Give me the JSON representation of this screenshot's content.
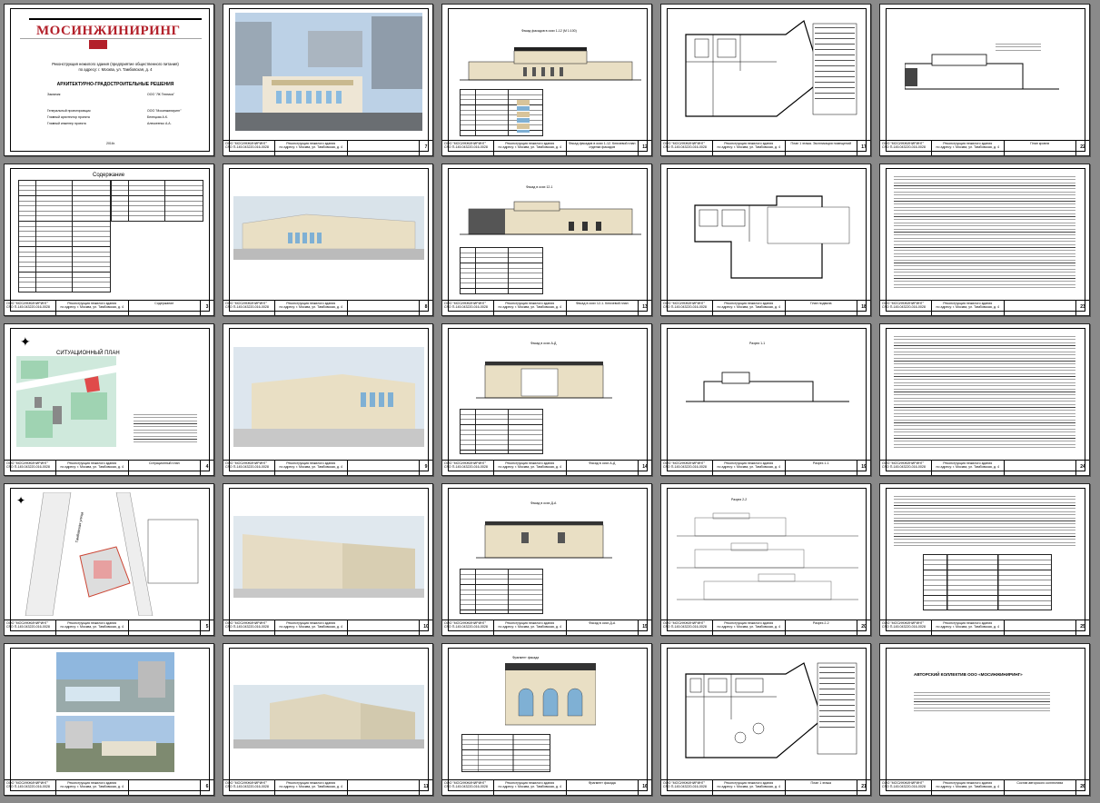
{
  "cover": {
    "logo_text": "МОСИНЖИНИРИНГ",
    "object_line1": "Реконструкция нежилого здания (предприятие общественного питания)",
    "object_line2": "по адресу: г. Москва, ул. Тамбовская, д. 4",
    "section_title": "АРХИТЕКТУРНО-ГРАДОСТРОИТЕЛЬНЫЕ РЕШЕНИЯ",
    "customer_label": "Заказчик",
    "customer_value": "ООО \"ЛК Техника\"",
    "designer_label": "Генеральный проектировщик",
    "designer_value": "ООО \"Мосинжиниринг\"",
    "chief_arch_label": "Главный архитектор проекта",
    "chief_arch_value": "Белецкая А.К.",
    "chief_eng_label": "Главный инженер проекта",
    "chief_eng_value": "Алексеенко А.А.",
    "year": "2016г."
  },
  "stamp": {
    "org_line1": "ООО \"МОСИНЖИНИРИНГ\"",
    "org_line2": "СРО П-145.043220-016-0028",
    "object_line1": "Реконструкция нежилого здания",
    "object_line2": "(предприятие общественного питания)",
    "object_line3": "по адресу: г. Москва, ул. Тамбовская, д. 4"
  },
  "sheets": [
    {
      "title": "",
      "label": "",
      "page": ""
    },
    {
      "title": "",
      "label": "",
      "page": "7"
    },
    {
      "title": "Фасад фасадов в осях 1-12 (М 1:100)",
      "label": "Фасад фасадов в осях 1-12. Ключевой план отделки фасадов",
      "page": "12"
    },
    {
      "title": "План 1 этажа",
      "label": "План 1 этажа. Экспликация помещений",
      "page": "17"
    },
    {
      "title": "План кровли",
      "label": "План кровли",
      "page": "22"
    },
    {
      "title": "Содержание",
      "label": "Содержание",
      "page": "3"
    },
    {
      "title": "",
      "label": "",
      "page": "8"
    },
    {
      "title": "Фасад в осях 12-1",
      "label": "Фасад в осях 12-1. Ключевой план",
      "page": "13"
    },
    {
      "title": "План подвала",
      "label": "План подвала",
      "page": "18"
    },
    {
      "title": "",
      "label": "",
      "page": "23"
    },
    {
      "title": "СИТУАЦИОННЫЙ ПЛАН",
      "label": "Ситуационный план",
      "page": "4"
    },
    {
      "title": "",
      "label": "",
      "page": "9"
    },
    {
      "title": "Фасад в осях А-Д",
      "label": "Фасад в осях А-Д",
      "page": "14"
    },
    {
      "title": "Разрез 1-1",
      "label": "Разрез 1-1",
      "page": "19"
    },
    {
      "title": "",
      "label": "",
      "page": "24"
    },
    {
      "title": "Тамбовская улица",
      "label": "",
      "page": "5"
    },
    {
      "title": "",
      "label": "",
      "page": "10"
    },
    {
      "title": "Фасад в осях Д-А",
      "label": "Фасад в осях Д-А",
      "page": "15"
    },
    {
      "title": "Разрез 2-2",
      "label": "Разрез 2-2",
      "page": "20"
    },
    {
      "title": "",
      "label": "",
      "page": "25"
    },
    {
      "title": "",
      "label": "",
      "page": "6"
    },
    {
      "title": "",
      "label": "",
      "page": "11"
    },
    {
      "title": "Фрагмент фасада",
      "label": "Фрагмент фасада",
      "page": "16"
    },
    {
      "title": "План 1 этажа",
      "label": "План 1 этажа",
      "page": "21"
    },
    {
      "title": "АВТОРСКИЙ КОЛЛЕКТИВ ООО «МОСИНЖИНИРИНГ»",
      "label": "Состав авторского коллектива",
      "page": "26"
    }
  ],
  "colors": {
    "logo_red": "#b3202a",
    "facade_beige": "#e9dfc4",
    "tile_blue": "#7fb0d4",
    "map_green": "#9fd3b2"
  }
}
